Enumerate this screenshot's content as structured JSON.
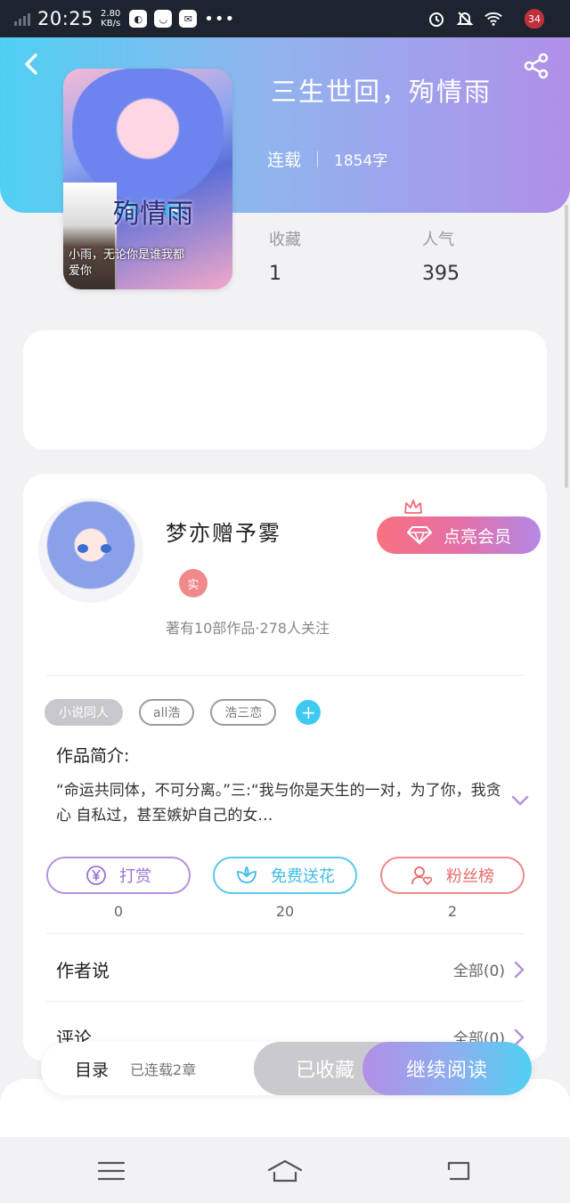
{
  "status_bar": {
    "time": "20:25",
    "speed_value": "2.80",
    "speed_unit": "KB/s",
    "battery": "34"
  },
  "book": {
    "title": "三生世回，殉情雨",
    "status": "连载",
    "word_count": "1854字",
    "cover_title": "殉情雨",
    "cover_caption": "小雨，无论你是谁我都",
    "cover_caption2": "爱你",
    "favorites_label": "收藏",
    "favorites_value": "1",
    "popularity_label": "人气",
    "popularity_value": "395"
  },
  "author": {
    "name": "梦亦赠予雾",
    "badge": "实",
    "stats": "著有10部作品·278人关注",
    "vip_button": "点亮会员"
  },
  "tags": [
    "小说同人",
    "all浩",
    "浩三恋"
  ],
  "intro": {
    "title": "作品简介:",
    "text": "“命运共同体，不可分离。”三:“我与你是天生的一对，为了你，我贪心 自私过，甚至嫉妒自己的女…"
  },
  "actions": [
    {
      "label": "打赏",
      "icon": "yen-icon",
      "count": "0"
    },
    {
      "label": "免费送花",
      "icon": "flower-icon",
      "count": "20"
    },
    {
      "label": "粉丝榜",
      "icon": "fan-ranking-icon",
      "count": "2"
    }
  ],
  "sections": {
    "author_says": "作者说",
    "author_says_all": "全部(0)",
    "comments": "评论",
    "comments_all": "全部(0)"
  },
  "bottom_bar": {
    "toc": "目录",
    "progress": "已连载2章",
    "favorited": "已收藏",
    "continue_reading": "继续阅读"
  },
  "colors": {
    "header_start": "#4fd0f2",
    "header_end": "#b08fe8",
    "accent_blue": "#3ec9f0",
    "accent_purple": "#b492dd",
    "accent_red": "#ee8a8a"
  }
}
